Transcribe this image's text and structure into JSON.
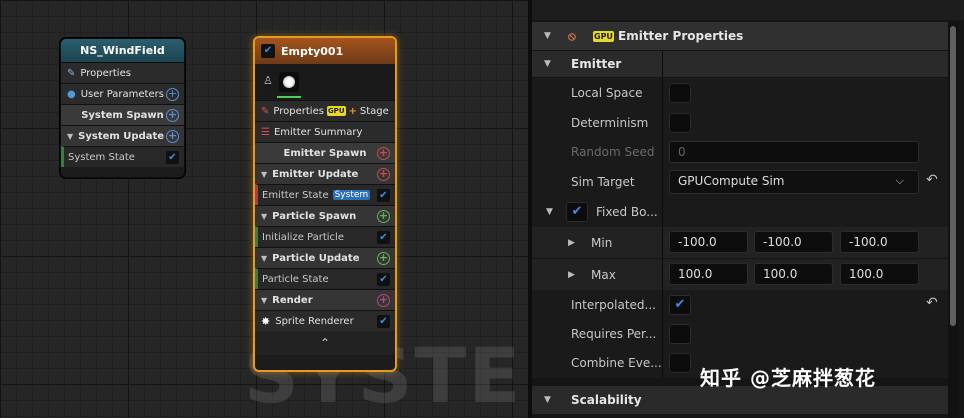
{
  "graph": {
    "watermark": "SYSTEM",
    "system_node": {
      "title": "NS_WindField",
      "rows": {
        "properties": "Properties",
        "user_parameters": "User Parameters",
        "system_spawn": "System Spawn",
        "system_update": "System Update",
        "system_state": "System State"
      }
    },
    "emitter_node": {
      "title": "Empty001",
      "properties": "Properties",
      "gpu_badge": "GPU",
      "stage": "Stage",
      "emitter_summary": "Emitter Summary",
      "emitter_spawn": "Emitter Spawn",
      "emitter_update": "Emitter Update",
      "emitter_state": "Emitter State",
      "system_tag": "System",
      "particle_spawn": "Particle Spawn",
      "initialize_particle": "Initialize Particle",
      "particle_update": "Particle Update",
      "particle_state": "Particle State",
      "render": "Render",
      "sprite_renderer": "Sprite Renderer"
    }
  },
  "details": {
    "header": {
      "gpu_badge": "GPU",
      "title": "Emitter Properties"
    },
    "emitter_category": "Emitter",
    "local_space": "Local Space",
    "determinism": "Determinism",
    "random_seed": {
      "label": "Random Seed",
      "value": "0"
    },
    "sim_target": {
      "label": "Sim Target",
      "value": "GPUCompute Sim"
    },
    "fixed_bounds": "Fixed Bo...",
    "min": {
      "label": "Min",
      "x": "-100.0",
      "y": "-100.0",
      "z": "-100.0"
    },
    "max": {
      "label": "Max",
      "x": "100.0",
      "y": "100.0",
      "z": "100.0"
    },
    "interpolated": "Interpolated...",
    "requires_per": "Requires Per...",
    "combine_eve": "Combine Eve...",
    "scalability_category": "Scalability"
  },
  "credit": "知乎 @芝麻拌葱花"
}
